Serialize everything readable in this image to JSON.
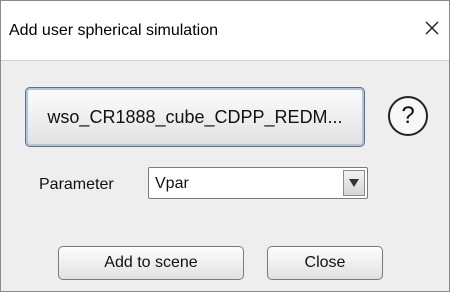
{
  "window": {
    "title": "Add user spherical simulation",
    "close_glyph": "×"
  },
  "file_button": {
    "label": "wso_CR1888_cube_CDPP_REDM..."
  },
  "help_button": {
    "label": "?"
  },
  "parameter": {
    "label": "Parameter",
    "selected": "Vpar"
  },
  "actions": {
    "add_label": "Add to scene",
    "close_label": "Close"
  },
  "colors": {
    "dialog_bg": "#eeeeee",
    "titlebar_bg": "#ffffff",
    "focus_ring": "#a9c6e6"
  }
}
